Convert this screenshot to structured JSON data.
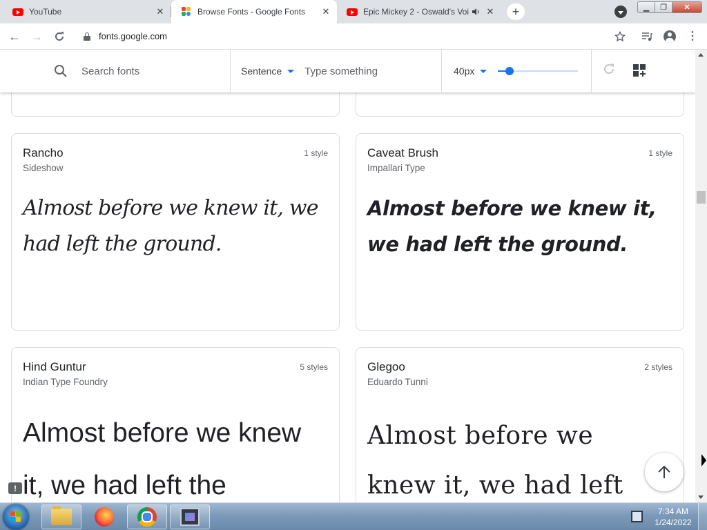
{
  "browser": {
    "tabs": [
      {
        "title": "YouTube",
        "favicon": "youtube-icon",
        "active": false
      },
      {
        "title": "Browse Fonts - Google Fonts",
        "favicon": "google-fonts-icon",
        "active": true
      },
      {
        "title": "Epic Mickey 2 - Oswald's Voi",
        "favicon": "youtube-icon",
        "active": false,
        "audio": true
      }
    ],
    "url": "fonts.google.com"
  },
  "toolbar": {
    "search_placeholder": "Search fonts",
    "preview_mode": "Sentence",
    "preview_placeholder": "Type something",
    "font_size": "40px",
    "font_size_slider_fraction": 0.14
  },
  "cards": [
    {
      "name": "Rancho",
      "designer": "Sideshow",
      "styles": "1 style",
      "sample": "Almost before we knew it, we had left the ground."
    },
    {
      "name": "Caveat Brush",
      "designer": "Impallari Type",
      "styles": "1 style",
      "sample": "Almost before we knew it, we had left the ground."
    },
    {
      "name": "Hind Guntur",
      "designer": "Indian Type Foundry",
      "styles": "5 styles",
      "sample": "Almost before we knew it, we had left the"
    },
    {
      "name": "Glegoo",
      "designer": "Eduardo Tunni",
      "styles": "2 styles",
      "sample": "Almost before we knew it, we had left"
    }
  ],
  "taskbar": {
    "time": "7:34 AM",
    "date": "1/24/2022"
  },
  "colors": {
    "accent": "#1a73e8",
    "youtube_red": "#ff0000"
  }
}
